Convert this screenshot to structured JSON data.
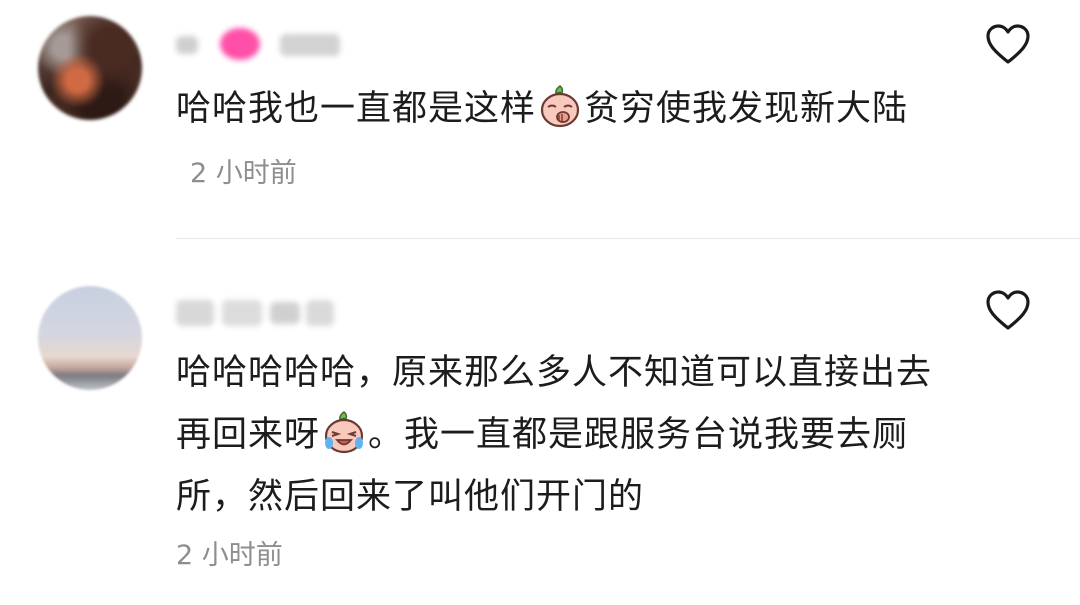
{
  "comments": [
    {
      "username_blurred": true,
      "text_part1": "哈哈我也一直都是这样",
      "emoji": "peach-facepalm-emoji",
      "text_part2": "贫穷使我发现新大陆",
      "timestamp": "2 小时前"
    },
    {
      "username_blurred": true,
      "text_part1": "哈哈哈哈哈，原来那么多人不知道可以直接出去再回来呀",
      "emoji": "peach-crying-laughing-emoji",
      "text_part2": "。我一直都是跟服务台说我要去厕所，然后回来了叫他们开门的",
      "timestamp": "2 小时前"
    }
  ],
  "icons": {
    "like": "heart-outline-icon"
  },
  "colors": {
    "text": "#1c1c1c",
    "timestamp": "#8e8e8e",
    "divider": "#e8e8e8"
  }
}
